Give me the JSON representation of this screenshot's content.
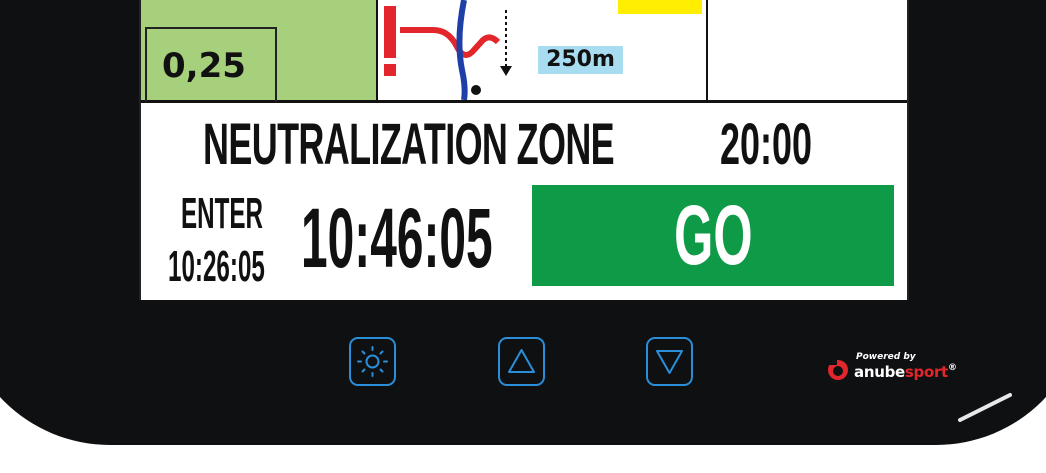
{
  "roadbook": {
    "distance": "0,25",
    "next_distance": "250m",
    "yellow_label": "",
    "colors": {
      "green_cell": "#a6d07c",
      "yellow_tag": "#ffee00",
      "distance_tag": "#a8dcf0"
    }
  },
  "zone": {
    "label": "NEUTRALIZATION ZONE",
    "duration": "20:00"
  },
  "enter": {
    "label": "ENTER",
    "time": "10:26:05"
  },
  "clock": "10:46:05",
  "status": {
    "label": "GO",
    "color": "#0f9a47"
  },
  "hardware_buttons": [
    {
      "icon": "brightness-icon"
    },
    {
      "icon": "up-arrow-icon"
    },
    {
      "icon": "down-arrow-icon"
    }
  ],
  "brand": {
    "powered_by": "Powered by",
    "name_part1": "anube",
    "name_part2": "sport",
    "registered": "®"
  }
}
